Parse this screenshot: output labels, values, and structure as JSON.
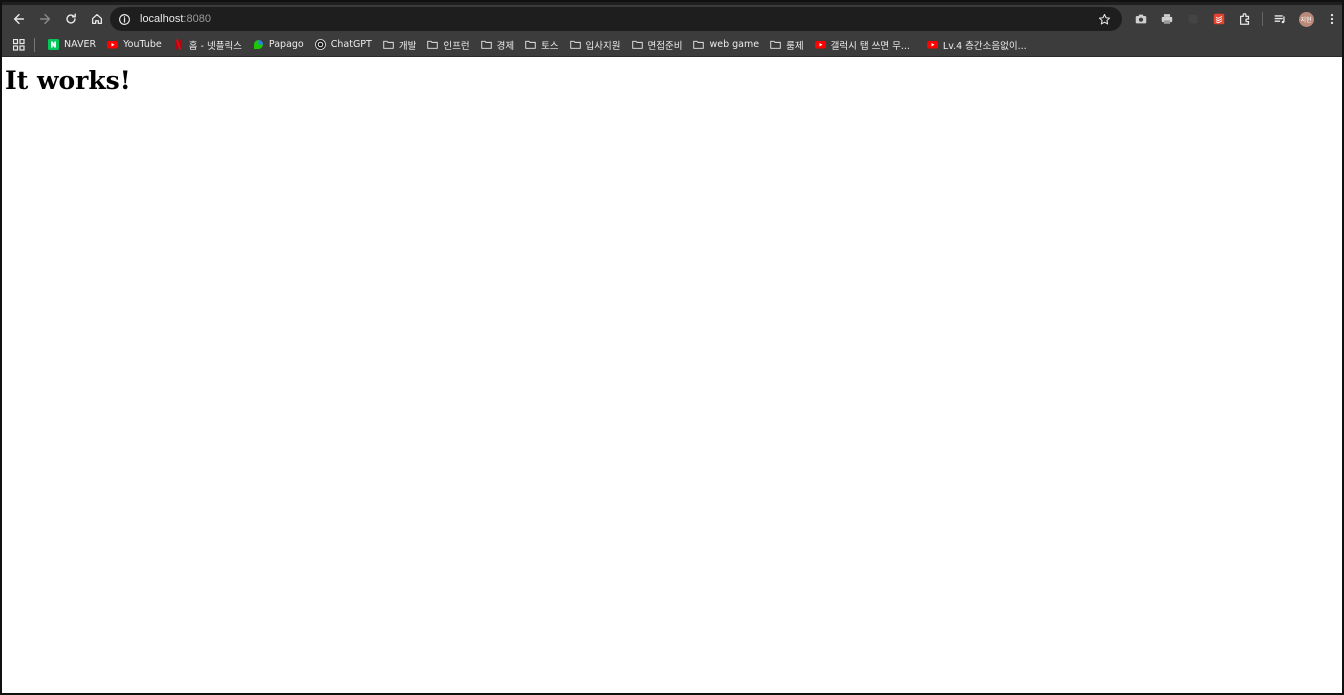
{
  "browser": {
    "address_bar": {
      "host": "localhost",
      "port": ":8080"
    },
    "profile_initials": "지현",
    "bookmarks": [
      {
        "label": "NAVER",
        "icon": "naver-icon",
        "color": "#03c75a"
      },
      {
        "label": "YouTube",
        "icon": "youtube-icon",
        "color": "#ff0000"
      },
      {
        "label": "홈 - 넷플릭스",
        "icon": "netflix-icon",
        "color": "#e50914"
      },
      {
        "label": "Papago",
        "icon": "papago-icon",
        "color": "#1ec800"
      },
      {
        "label": "ChatGPT",
        "icon": "chatgpt-icon",
        "color": "#ffffff"
      },
      {
        "label": "개발",
        "icon": "folder-icon"
      },
      {
        "label": "인프런",
        "icon": "folder-icon"
      },
      {
        "label": "경제",
        "icon": "folder-icon"
      },
      {
        "label": "토스",
        "icon": "folder-icon"
      },
      {
        "label": "입사지원",
        "icon": "folder-icon"
      },
      {
        "label": "면접준비",
        "icon": "folder-icon"
      },
      {
        "label": "web game",
        "icon": "folder-icon"
      },
      {
        "label": "룸제",
        "icon": "folder-icon"
      },
      {
        "label": "갤럭시 탭 쓰면 무...",
        "icon": "youtube-icon",
        "color": "#ff0000"
      },
      {
        "label": "Lv.4 층간소음없이...",
        "icon": "youtube-icon",
        "color": "#ff0000"
      }
    ]
  },
  "page": {
    "heading": "It works!"
  }
}
